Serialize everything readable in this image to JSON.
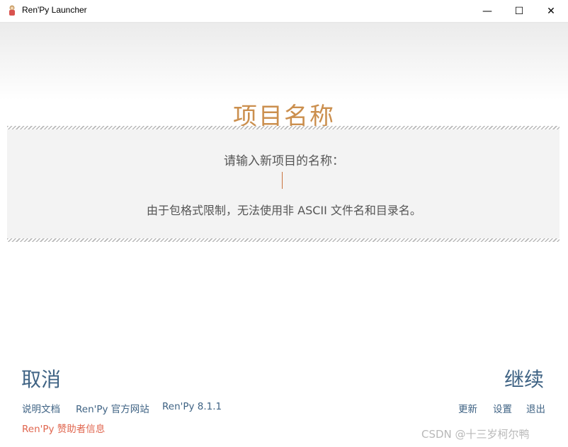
{
  "window": {
    "title": "Ren'Py Launcher",
    "minimize_glyph": "—",
    "maximize_glyph": "☐",
    "close_glyph": "✕"
  },
  "page": {
    "heading": "项目名称",
    "prompt": "请输入新项目的名称：",
    "input_value": "",
    "note": "由于包格式限制，无法使用非 ASCII 文件名和目录名。"
  },
  "actions": {
    "cancel": "取消",
    "continue": "继续"
  },
  "footer": {
    "left_links": [
      "说明文档",
      "Ren'Py 官方网站",
      "Ren'Py 8.1.1"
    ],
    "right_links": [
      "更新",
      "设置",
      "退出"
    ],
    "sponsor": "Ren'Py 赞助者信息"
  },
  "watermark": "CSDN @十三岁柯尔鸭",
  "colors": {
    "heading": "#cb8f4e",
    "link": "#3f6384",
    "sponsor": "#e0664f",
    "caret": "#c9733e"
  }
}
